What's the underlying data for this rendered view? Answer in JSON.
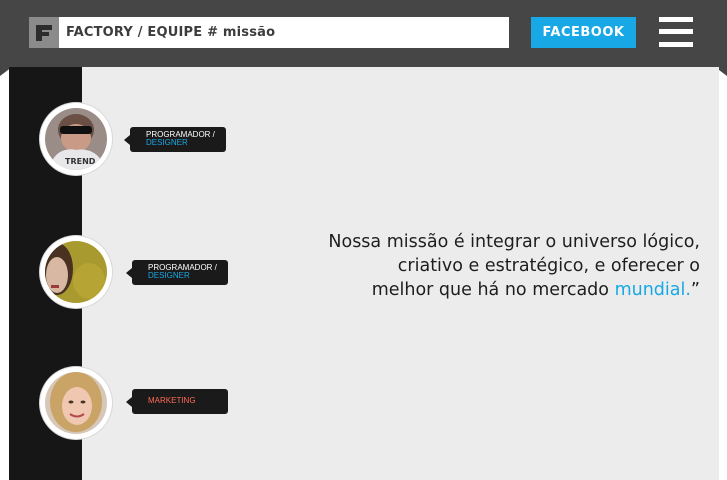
{
  "header": {
    "logo_letter": "F",
    "breadcrumb": "FACTORY / EQUIPE # missão",
    "facebook_label": "FACEBOOK",
    "menu_icon": "hamburger-menu-icon"
  },
  "team": [
    {
      "role_line1": "PROGRAMADOR /",
      "role_line2": "DESIGNER"
    },
    {
      "role_line1": "PROGRAMADOR /",
      "role_line2": "DESIGNER"
    },
    {
      "role_line1": "MARKETING"
    }
  ],
  "mission": {
    "line1": "Nossa missão é integrar o universo lógico,",
    "line2": "criativo e estratégico, e oferecer o",
    "line3_start": "melhor que há no mercado ",
    "highlight": "mundial.",
    "closing": "”"
  },
  "colors": {
    "accent": "#18a8e6",
    "header_bg": "#464646",
    "sidebar_bg": "#161616",
    "content_bg": "#ececec",
    "marketing_label": "#ff6a55"
  }
}
